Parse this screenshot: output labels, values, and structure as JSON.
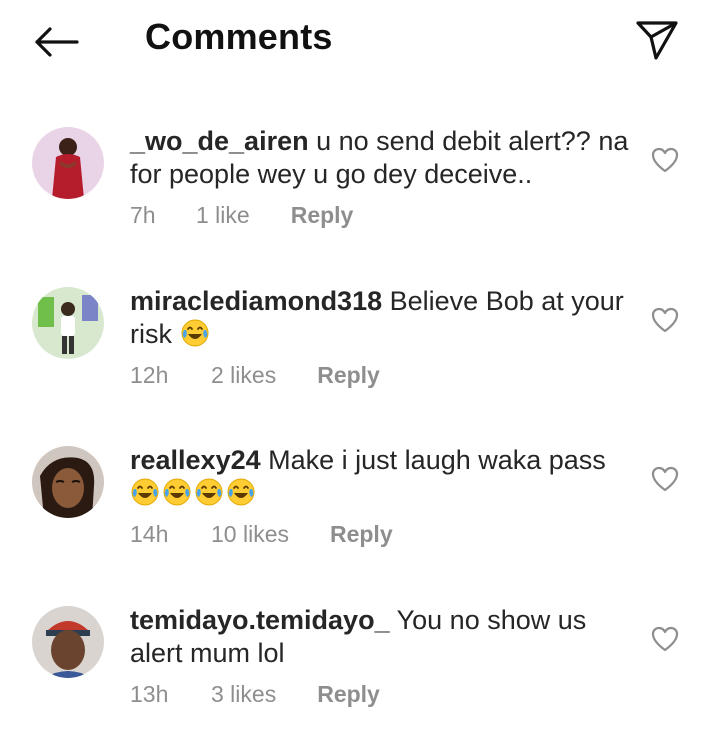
{
  "header": {
    "title": "Comments",
    "back_icon": "arrow-left-icon",
    "send_icon": "paper-plane-icon"
  },
  "comments": [
    {
      "username": "_wo_de_airen",
      "text": "u no send debit alert?? na for people wey u go dey deceive..",
      "emoji_count": 0,
      "time": "7h",
      "likes": "1 like",
      "reply": "Reply"
    },
    {
      "username": "miraclediamond318",
      "text": "Believe Bob at your risk",
      "emoji_count": 1,
      "time": "12h",
      "likes": "2 likes",
      "reply": "Reply"
    },
    {
      "username": "reallexy24",
      "text": "Make i just laugh waka pass",
      "emoji_count": 4,
      "time": "14h",
      "likes": "10 likes",
      "reply": "Reply"
    },
    {
      "username": "temidayo.temidayo_",
      "text": "You no show us alert mum lol",
      "emoji_count": 0,
      "time": "13h",
      "likes": "3 likes",
      "reply": "Reply"
    }
  ],
  "colors": {
    "text": "#262626",
    "secondary": "#8e8e8e",
    "background": "#ffffff"
  }
}
